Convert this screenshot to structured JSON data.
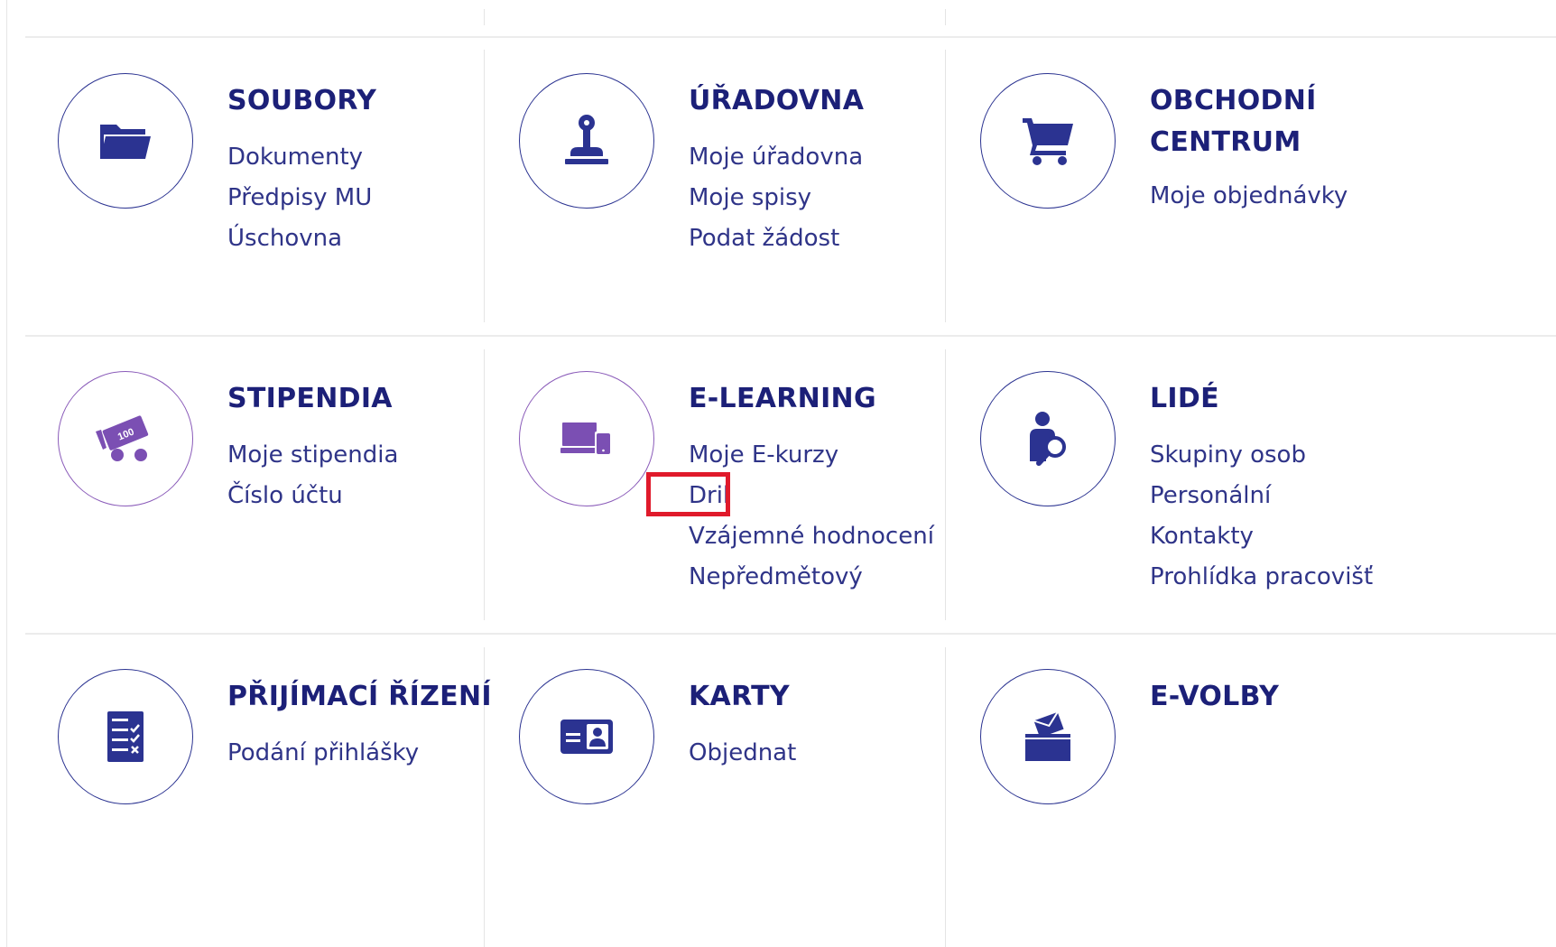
{
  "tiles": [
    {
      "title": "SOUBORY",
      "icon": "folder-icon",
      "links": [
        "Dokumenty",
        "Předpisy MU",
        "Úschovna"
      ]
    },
    {
      "title": "ÚŘADOVNA",
      "icon": "stamp-icon",
      "links": [
        "Moje úřadovna",
        "Moje spisy",
        "Podat žádost"
      ]
    },
    {
      "title": "OBCHODNÍ CENTRUM",
      "icon": "shopping-cart-icon",
      "links": [
        "Moje objednávky"
      ]
    },
    {
      "title": "STIPENDIA",
      "icon": "money-cart-icon",
      "links": [
        "Moje stipendia",
        "Číslo účtu"
      ]
    },
    {
      "title": "E-LEARNING",
      "icon": "devices-icon",
      "links": [
        "Moje E-kurzy",
        "Dril",
        "Vzájemné hodnocení",
        "Nepředmětový"
      ]
    },
    {
      "title": "LIDÉ",
      "icon": "person-search-icon",
      "links": [
        "Skupiny osob",
        "Personální",
        "Kontakty",
        "Prohlídka pracovišť"
      ]
    },
    {
      "title": "PŘIJÍMACÍ ŘÍZENÍ",
      "icon": "checklist-icon",
      "links": [
        "Podání přihlášky"
      ]
    },
    {
      "title": "KARTY",
      "icon": "id-card-icon",
      "links": [
        "Objednat"
      ]
    },
    {
      "title": "E-VOLBY",
      "icon": "ballot-box-icon",
      "links": []
    }
  ],
  "highlighted_link": "Dril",
  "colors": {
    "title": "#1c2078",
    "link": "#2f3488",
    "icon_blue": "#2b3391",
    "icon_purple": "#8a5bb9",
    "highlight": "#e01a2b"
  }
}
